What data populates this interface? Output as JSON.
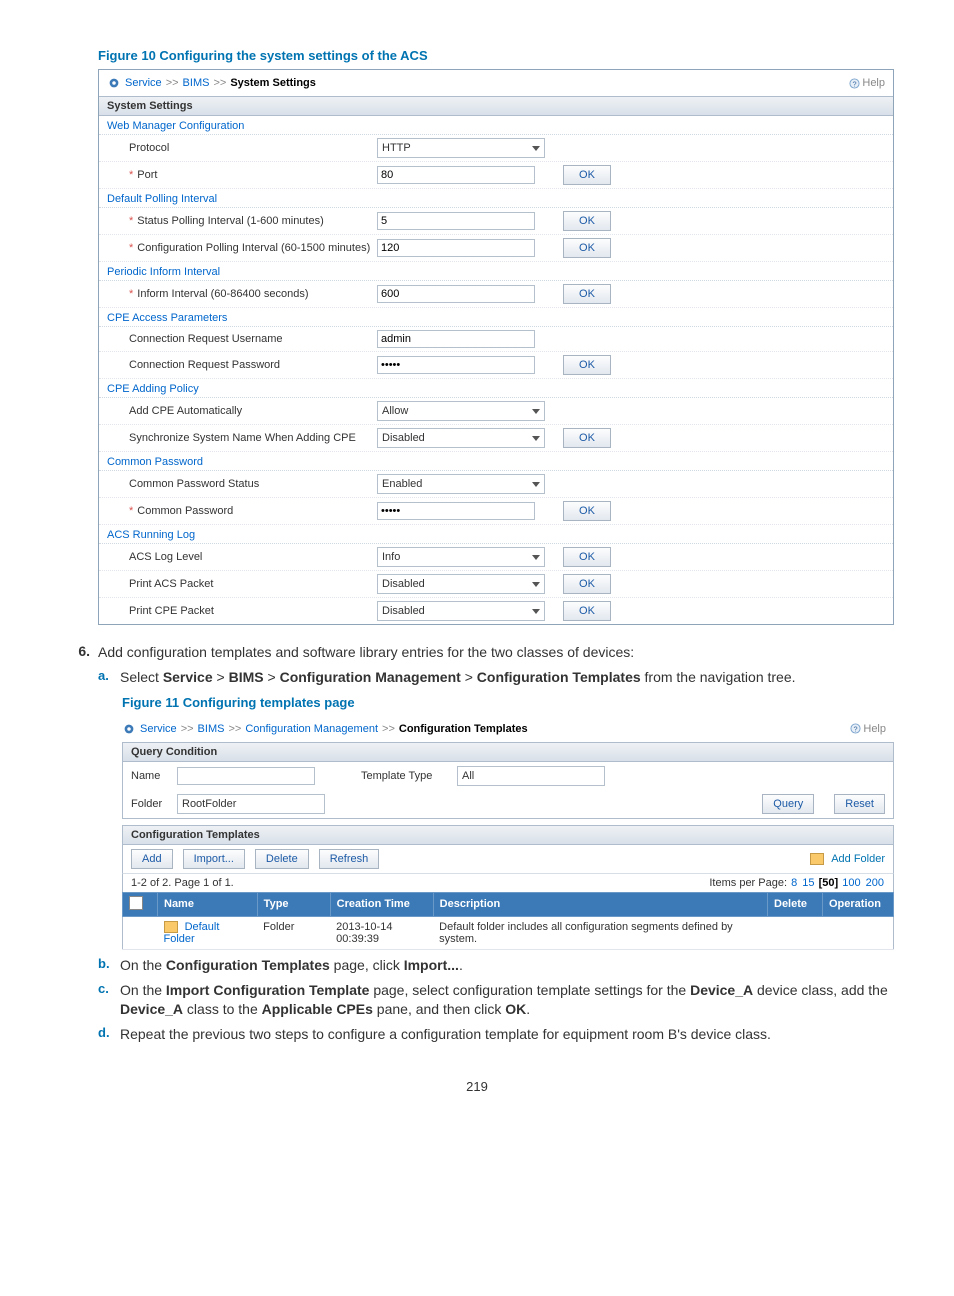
{
  "fig10": {
    "caption": "Figure 10 Configuring the system settings of the ACS",
    "breadcrumb": {
      "service": "Service",
      "sep": ">>",
      "bims": "BIMS",
      "current": "System Settings",
      "help": "Help"
    },
    "section": "System Settings",
    "groups": {
      "webmgr": {
        "title": "Web Manager Configuration",
        "protocol_lbl": "Protocol",
        "protocol_val": "HTTP",
        "port_lbl": "Port",
        "port_val": "80",
        "ok": "OK"
      },
      "defpoll": {
        "title": "Default Polling Interval",
        "status_lbl": "Status Polling Interval (1-600 minutes)",
        "status_val": "5",
        "conf_lbl": "Configuration Polling Interval (60-1500 minutes)",
        "conf_val": "120"
      },
      "periodic": {
        "title": "Periodic Inform Interval",
        "inform_lbl": "Inform Interval (60-86400 seconds)",
        "inform_val": "600"
      },
      "cpeaccess": {
        "title": "CPE Access Parameters",
        "user_lbl": "Connection Request Username",
        "user_val": "admin",
        "pass_lbl": "Connection Request Password",
        "pass_val": "•••••"
      },
      "cpeadd": {
        "title": "CPE Adding Policy",
        "auto_lbl": "Add CPE Automatically",
        "auto_val": "Allow",
        "sync_lbl": "Synchronize System Name When Adding CPE",
        "sync_val": "Disabled"
      },
      "commonpw": {
        "title": "Common Password",
        "status_lbl": "Common Password Status",
        "status_val": "Enabled",
        "pw_lbl": "Common Password",
        "pw_val": "•••••"
      },
      "acslog": {
        "title": "ACS Running Log",
        "level_lbl": "ACS Log Level",
        "level_val": "Info",
        "acs_lbl": "Print ACS Packet",
        "acs_val": "Disabled",
        "cpe_lbl": "Print CPE Packet",
        "cpe_val": "Disabled"
      }
    }
  },
  "step6": {
    "num": "6.",
    "text": "Add configuration templates and software library entries for the two classes of devices:",
    "a_num": "a.",
    "a_text_pre": "Select ",
    "a_svc": "Service",
    "a_gt": " > ",
    "a_bims": "BIMS",
    "a_cm": "Configuration Management",
    "a_ct": "Configuration Templates",
    "a_text_post": " from the navigation tree."
  },
  "fig11": {
    "caption": "Figure 11 Configuring templates page",
    "breadcrumb": {
      "service": "Service",
      "sep": ">>",
      "bims": "BIMS",
      "cm": "Configuration Management",
      "ct": "Configuration Templates",
      "help": "Help"
    },
    "query": {
      "section": "Query Condition",
      "name_lbl": "Name",
      "tt_lbl": "Template Type",
      "tt_val": "All",
      "folder_lbl": "Folder",
      "folder_val": "RootFolder",
      "query_btn": "Query",
      "reset_btn": "Reset"
    },
    "grid": {
      "section": "Configuration Templates",
      "add": "Add",
      "import": "Import...",
      "delete": "Delete",
      "refresh": "Refresh",
      "addfolder": "Add Folder",
      "paging_left": "1-2 of 2. Page 1 of 1.",
      "ipp_label": "Items per Page:",
      "ipp_8": "8",
      "ipp_15": "15",
      "ipp_50": "[50]",
      "ipp_100": "100",
      "ipp_200": "200",
      "hdr_name": "Name",
      "hdr_type": "Type",
      "hdr_ctime": "Creation Time",
      "hdr_desc": "Description",
      "hdr_del": "Delete",
      "hdr_op": "Operation",
      "row_name": "Default Folder",
      "row_type": "Folder",
      "row_ctime": "2013-10-14 00:39:39",
      "row_desc": "Default folder includes all configuration segments defined by system."
    }
  },
  "steps_bcd": {
    "b_num": "b.",
    "b_pre": "On the ",
    "b_ct": "Configuration Templates",
    "b_mid": " page, click ",
    "b_imp": "Import...",
    "b_end": ".",
    "c_num": "c.",
    "c_pre": "On the ",
    "c_ict": "Import Configuration Template",
    "c_mid1": " page, select configuration template settings for the ",
    "c_da1": "Device_A",
    "c_mid2": " device class, add the ",
    "c_da2": "Device_A",
    "c_mid3": " class to the ",
    "c_ac": "Applicable CPEs",
    "c_mid4": " pane, and then click ",
    "c_ok": "OK",
    "c_end": ".",
    "d_num": "d.",
    "d_text": "Repeat the previous two steps to configure a configuration template for equipment room B's device class."
  },
  "page_number": "219",
  "ok_label": "OK"
}
